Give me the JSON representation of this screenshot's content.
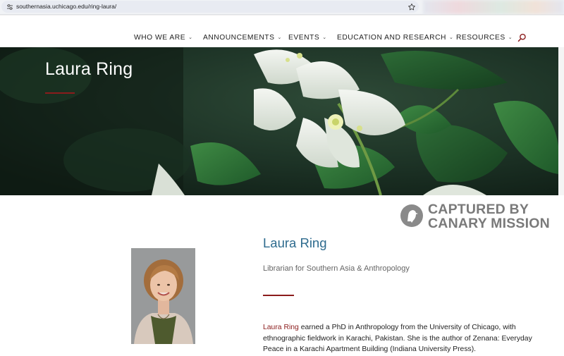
{
  "browser": {
    "url": "southernasia.uchicago.edu/ring-laura/",
    "icons": {
      "site_info": "tune-icon",
      "bookmark": "star-icon"
    }
  },
  "nav": {
    "items": [
      {
        "label": "WHO WE ARE",
        "icon": "chevron-down-icon"
      },
      {
        "label": "ANNOUNCEMENTS",
        "icon": "chevron-down-icon"
      },
      {
        "label": "EVENTS",
        "icon": "chevron-down-icon"
      },
      {
        "label": "EDUCATION AND RESEARCH",
        "icon": "chevron-down-icon"
      },
      {
        "label": "RESOURCES",
        "icon": "chevron-down-icon"
      }
    ],
    "search_icon": "search-icon"
  },
  "hero": {
    "title": "Laura Ring"
  },
  "watermark": {
    "line1": "CAPTURED BY",
    "line2": "CANARY MISSION"
  },
  "profile": {
    "name": "Laura Ring",
    "subtitle": "Librarian for Southern Asia & Anthropology",
    "bio_lead": "Laura Ring",
    "bio_rest": " earned a PhD in Anthropology from the University of Chicago, with ethnographic fieldwork in Karachi, Pakistan. She is the author of Zenana: Everyday Peace in a Karachi Apartment Building (Indiana University Press)."
  },
  "colors": {
    "accent_red": "#8b1c1c",
    "name_blue": "#2e6b8e",
    "watermark_gray": "#7a7a7a"
  }
}
